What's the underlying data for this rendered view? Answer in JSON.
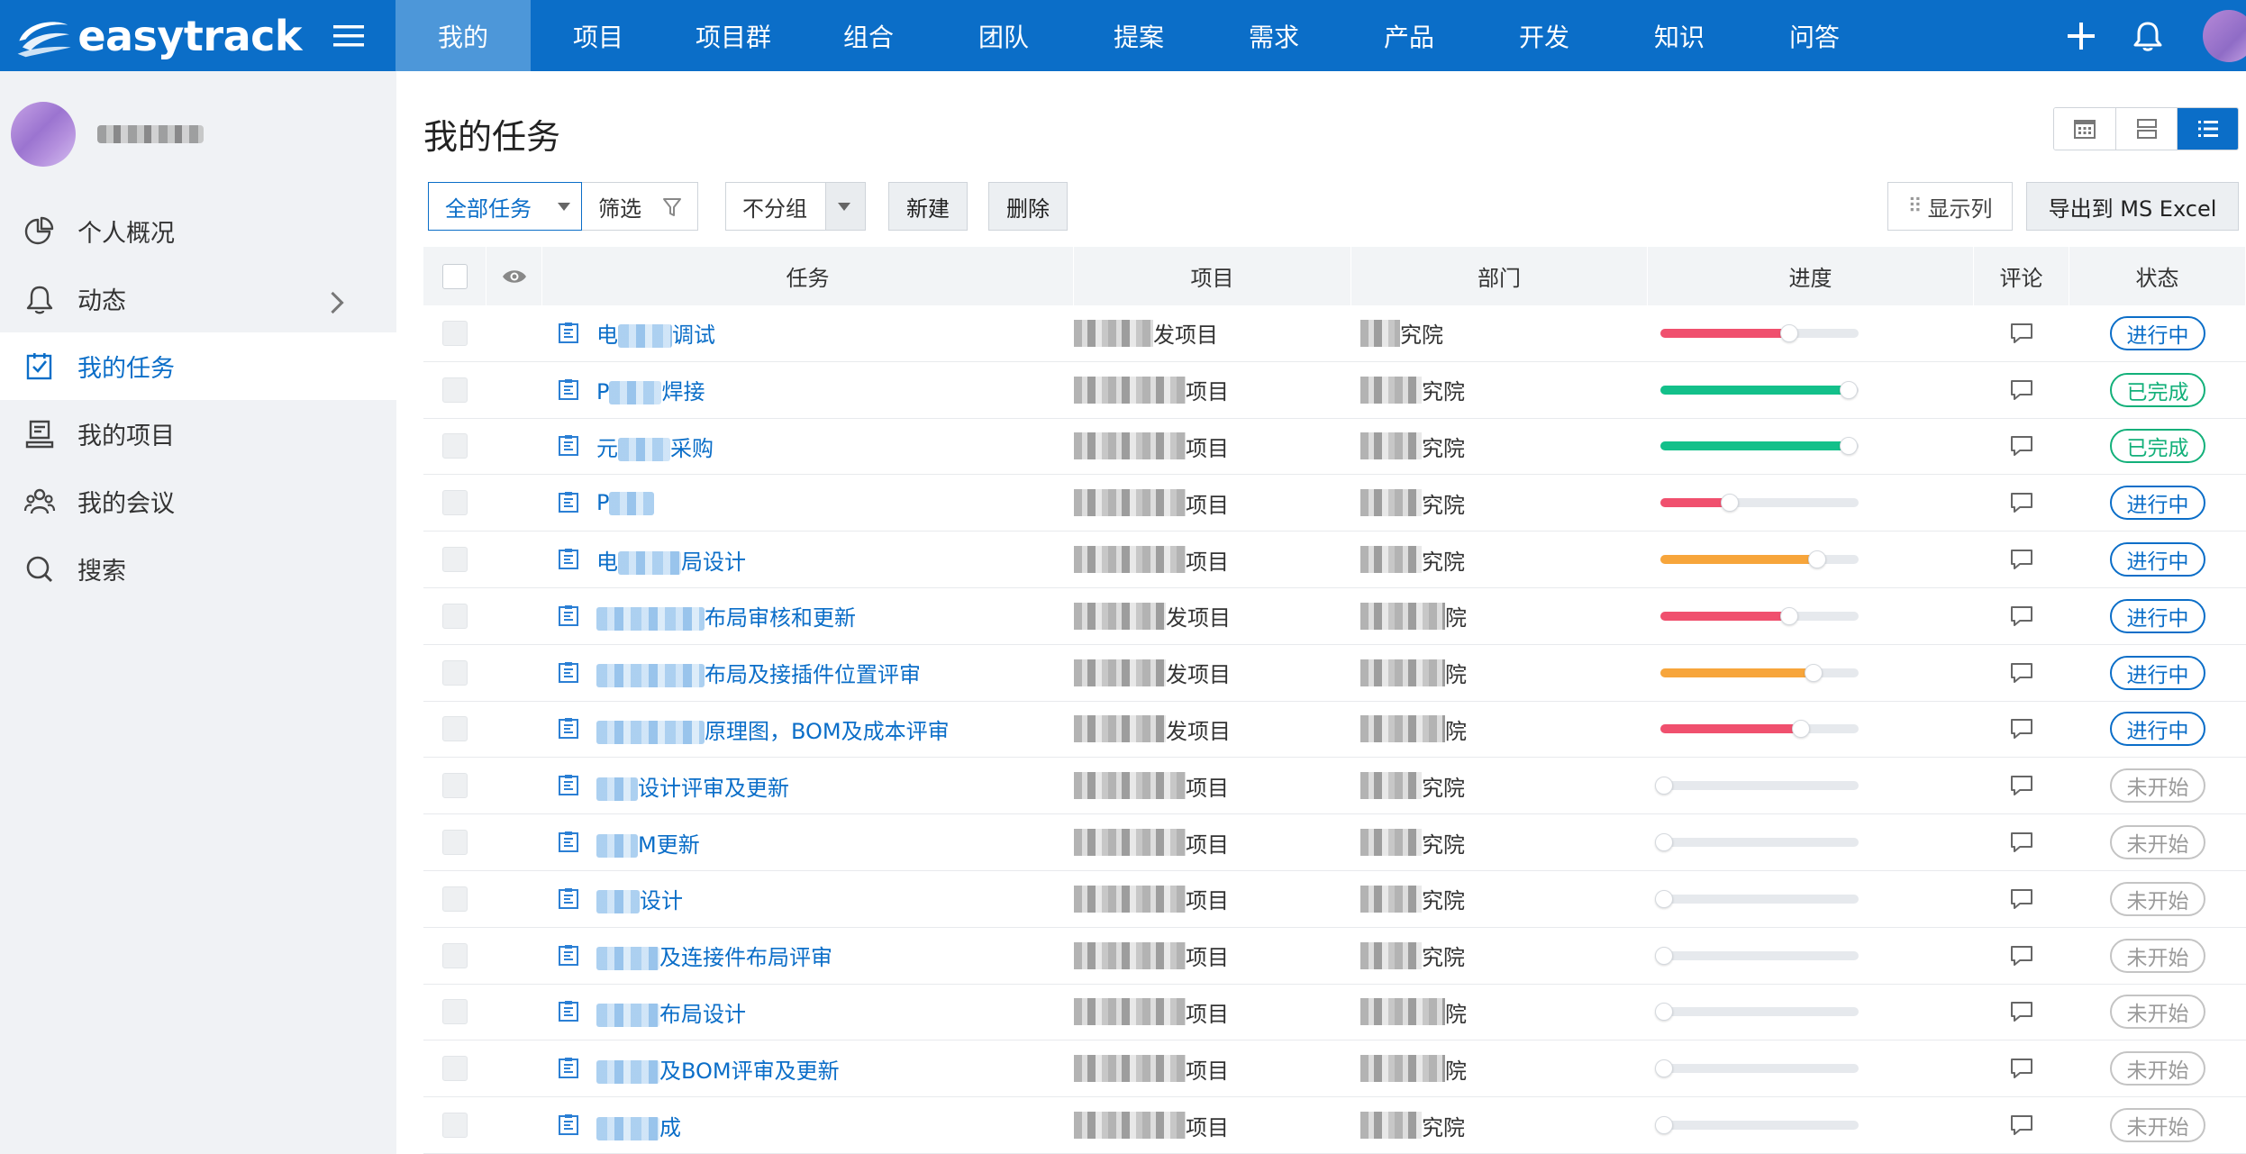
{
  "brand": {
    "name": "easytrack"
  },
  "nav": [
    {
      "label": "我的",
      "active": true
    },
    {
      "label": "项目"
    },
    {
      "label": "项目群"
    },
    {
      "label": "组合"
    },
    {
      "label": "团队"
    },
    {
      "label": "提案"
    },
    {
      "label": "需求"
    },
    {
      "label": "产品"
    },
    {
      "label": "开发"
    },
    {
      "label": "知识"
    },
    {
      "label": "问答"
    }
  ],
  "top_actions": {
    "add_icon": "plus-icon",
    "bell_icon": "bell-icon",
    "avatar": "user-avatar"
  },
  "sidebar": {
    "items": [
      {
        "label": "个人概况",
        "icon": "pie-chart-icon"
      },
      {
        "label": "动态",
        "icon": "bell-icon",
        "has_children": true
      },
      {
        "label": "我的任务",
        "icon": "task-check-icon",
        "active": true
      },
      {
        "label": "我的项目",
        "icon": "project-icon"
      },
      {
        "label": "我的会议",
        "icon": "meeting-icon"
      },
      {
        "label": "搜索",
        "icon": "search-icon"
      }
    ]
  },
  "page": {
    "title": "我的任务"
  },
  "view_switch": [
    "calendar-view-icon",
    "card-view-icon",
    "list-view-icon"
  ],
  "toolbar": {
    "scope": "全部任务",
    "filter": "筛选",
    "group": "不分组",
    "new": "新建",
    "delete": "删除",
    "columns": "显示列",
    "export": "导出到 MS Excel"
  },
  "columns": {
    "task": "任务",
    "project": "项目",
    "dept": "部门",
    "progress": "进度",
    "comment": "评论",
    "status": "状态"
  },
  "colors": {
    "brand": "#0b6ec8",
    "red": "#f0506e",
    "green": "#13c08a",
    "orange": "#f7a53b"
  },
  "status_labels": {
    "progress": "进行中",
    "done": "已完成",
    "todo": "未开始"
  },
  "rows": [
    {
      "task": "调试",
      "project": "发项目",
      "dept": "究院",
      "progress": 0.66,
      "color": "red",
      "status": "进行中",
      "kind": "progress",
      "task_blur": 60,
      "task_prefix": "电",
      "proj_blur": 88,
      "dept_blur": 44,
      "dept_prefix": ""
    },
    {
      "task": "焊接",
      "project": "项目",
      "dept": "究院",
      "progress": 0.96,
      "color": "green",
      "status": "已完成",
      "kind": "done",
      "task_blur": 58,
      "task_prefix": "P",
      "proj_blur": 124,
      "dept_blur": 68
    },
    {
      "task": "采购",
      "project": "项目",
      "dept": "究院",
      "progress": 0.96,
      "color": "green",
      "status": "已完成",
      "kind": "done",
      "task_blur": 58,
      "task_prefix": "元",
      "proj_blur": 124,
      "dept_blur": 68
    },
    {
      "task": "",
      "project": "项目",
      "dept": "究院",
      "progress": 0.36,
      "color": "red",
      "status": "进行中",
      "kind": "progress",
      "task_blur": 50,
      "task_prefix": "P",
      "proj_blur": 124,
      "dept_blur": 68
    },
    {
      "task": "局设计",
      "project": "项目",
      "dept": "究院",
      "progress": 0.8,
      "color": "orange",
      "status": "进行中",
      "kind": "progress",
      "task_blur": 70,
      "task_prefix": "电",
      "proj_blur": 124,
      "dept_blur": 68
    },
    {
      "task": "布局审核和更新",
      "project": "发项目",
      "dept": "院",
      "progress": 0.66,
      "color": "red",
      "status": "进行中",
      "kind": "progress",
      "task_blur": 120,
      "task_prefix": "",
      "proj_blur": 102,
      "dept_blur": 94
    },
    {
      "task": "布局及接插件位置评审",
      "project": "发项目",
      "dept": "院",
      "progress": 0.78,
      "color": "orange",
      "status": "进行中",
      "kind": "progress",
      "task_blur": 120,
      "task_prefix": "",
      "proj_blur": 102,
      "dept_blur": 94
    },
    {
      "task": "原理图，BOM及成本评审",
      "project": "发项目",
      "dept": "院",
      "progress": 0.72,
      "color": "red",
      "status": "进行中",
      "kind": "progress",
      "task_blur": 120,
      "task_prefix": "",
      "proj_blur": 102,
      "dept_blur": 94
    },
    {
      "task": "设计评审及更新",
      "project": "项目",
      "dept": "究院",
      "progress": 0,
      "color": "red",
      "status": "未开始",
      "kind": "todo",
      "task_blur": 46,
      "task_prefix": "",
      "proj_blur": 124,
      "dept_blur": 68
    },
    {
      "task": "M更新",
      "project": "项目",
      "dept": "究院",
      "progress": 0,
      "color": "red",
      "status": "未开始",
      "kind": "todo",
      "task_blur": 46,
      "task_prefix": "",
      "proj_blur": 124,
      "dept_blur": 68
    },
    {
      "task": "设计",
      "project": "项目",
      "dept": "究院",
      "progress": 0,
      "color": "red",
      "status": "未开始",
      "kind": "todo",
      "task_blur": 48,
      "task_prefix": "",
      "proj_blur": 124,
      "dept_blur": 68
    },
    {
      "task": "及连接件布局评审",
      "project": "项目",
      "dept": "究院",
      "progress": 0,
      "color": "red",
      "status": "未开始",
      "kind": "todo",
      "task_blur": 70,
      "task_prefix": "",
      "proj_blur": 124,
      "dept_blur": 68
    },
    {
      "task": "布局设计",
      "project": "项目",
      "dept": "院",
      "progress": 0,
      "color": "red",
      "status": "未开始",
      "kind": "todo",
      "task_blur": 70,
      "task_prefix": "",
      "proj_blur": 124,
      "dept_blur": 94
    },
    {
      "task": "及BOM评审及更新",
      "project": "项目",
      "dept": "院",
      "progress": 0,
      "color": "red",
      "status": "未开始",
      "kind": "todo",
      "task_blur": 70,
      "task_prefix": "",
      "proj_blur": 124,
      "dept_blur": 94
    },
    {
      "task": "成",
      "project": "项目",
      "dept": "究院",
      "progress": 0,
      "color": "red",
      "status": "未开始",
      "kind": "todo",
      "task_blur": 70,
      "task_prefix": "",
      "proj_blur": 124,
      "dept_blur": 68
    }
  ]
}
